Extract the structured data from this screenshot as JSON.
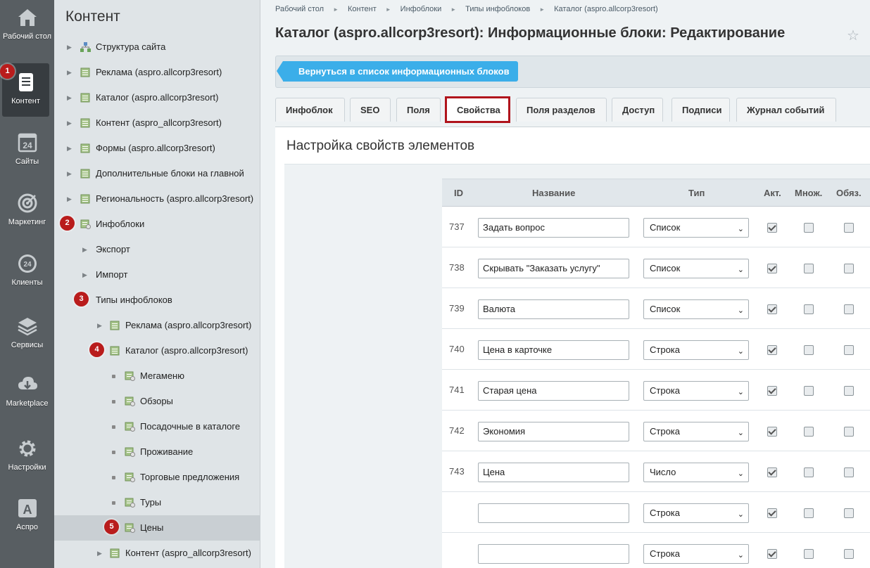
{
  "rail": {
    "items": [
      {
        "label": "Рабочий стол",
        "icon": "home-icon"
      },
      {
        "label": "Контент",
        "icon": "document-icon",
        "active": true
      },
      {
        "label": "Сайты",
        "icon": "calendar-24-icon"
      },
      {
        "label": "Маркетинг",
        "icon": "target-icon"
      },
      {
        "label": "Клиенты",
        "icon": "clients-24-icon"
      },
      {
        "label": "Сервисы",
        "icon": "layers-icon"
      },
      {
        "label": "Marketplace",
        "icon": "cloud-download-icon"
      },
      {
        "label": "Настройки",
        "icon": "gear-icon"
      },
      {
        "label": "Аспро",
        "icon": "letter-a-icon"
      }
    ],
    "calendar_number": "24",
    "clients_number": "24",
    "aspro_letter": "A"
  },
  "tree": {
    "title": "Контент",
    "nodes": [
      {
        "label": "Структура сайта"
      },
      {
        "label": "Реклама (aspro.allcorp3resort)"
      },
      {
        "label": "Каталог (aspro.allcorp3resort)"
      },
      {
        "label": "Контент (aspro_allcorp3resort)"
      },
      {
        "label": "Формы (aspro.allcorp3resort)"
      },
      {
        "label": "Дополнительные блоки на главной"
      },
      {
        "label": "Региональность (aspro.allcorp3resort)"
      },
      {
        "label": "Инфоблоки"
      },
      {
        "label": "Экспорт"
      },
      {
        "label": "Импорт"
      },
      {
        "label": "Типы инфоблоков"
      },
      {
        "label": "Реклама (aspro.allcorp3resort)"
      },
      {
        "label": "Каталог (aspro.allcorp3resort)"
      },
      {
        "label": "Мегаменю"
      },
      {
        "label": "Обзоры"
      },
      {
        "label": "Посадочные в каталоге"
      },
      {
        "label": "Проживание"
      },
      {
        "label": "Торговые предложения"
      },
      {
        "label": "Туры"
      },
      {
        "label": "Цены"
      },
      {
        "label": "Контент (aspro_allcorp3resort)"
      }
    ]
  },
  "badges": [
    "1",
    "2",
    "3",
    "4",
    "5"
  ],
  "breadcrumb": [
    "Рабочий стол",
    "Контент",
    "Инфоблоки",
    "Типы инфоблоков",
    "Каталог (aspro.allcorp3resort)"
  ],
  "page_title": "Каталог (aspro.allcorp3resort): Информационные блоки: Редактирование",
  "back_button": "Вернуться в список информационных блоков",
  "tabs": [
    {
      "label": "Инфоблок"
    },
    {
      "label": "SEO"
    },
    {
      "label": "Поля"
    },
    {
      "label": "Свойства",
      "active": true
    },
    {
      "label": "Поля разделов"
    },
    {
      "label": "Доступ"
    },
    {
      "label": "Подписи"
    },
    {
      "label": "Журнал событий"
    }
  ],
  "section_title": "Настройка свойств элементов",
  "table": {
    "headers": {
      "id": "ID",
      "name": "Название",
      "type": "Тип",
      "active": "Акт.",
      "multiple": "Множ.",
      "required": "Обяз."
    },
    "rows": [
      {
        "id": "737",
        "name": "Задать вопрос",
        "type": "Список",
        "active": true,
        "multiple": false,
        "required": false
      },
      {
        "id": "738",
        "name": "Скрывать \"Заказать услугу\"",
        "type": "Список",
        "active": true,
        "multiple": false,
        "required": false
      },
      {
        "id": "739",
        "name": "Валюта",
        "type": "Список",
        "active": true,
        "multiple": false,
        "required": false
      },
      {
        "id": "740",
        "name": "Цена в карточке",
        "type": "Строка",
        "active": true,
        "multiple": false,
        "required": false
      },
      {
        "id": "741",
        "name": "Старая цена",
        "type": "Строка",
        "active": true,
        "multiple": false,
        "required": false
      },
      {
        "id": "742",
        "name": "Экономия",
        "type": "Строка",
        "active": true,
        "multiple": false,
        "required": false
      },
      {
        "id": "743",
        "name": "Цена",
        "type": "Число",
        "active": true,
        "multiple": false,
        "required": false
      },
      {
        "id": "",
        "name": "",
        "type": "Строка",
        "active": true,
        "multiple": false,
        "required": false
      },
      {
        "id": "",
        "name": "",
        "type": "Строка",
        "active": true,
        "multiple": false,
        "required": false
      }
    ]
  },
  "colors": {
    "accent": "#3baee9",
    "badge": "#b91c1c",
    "rail": "#585e62",
    "active_tab_outline": "#b0141c"
  }
}
